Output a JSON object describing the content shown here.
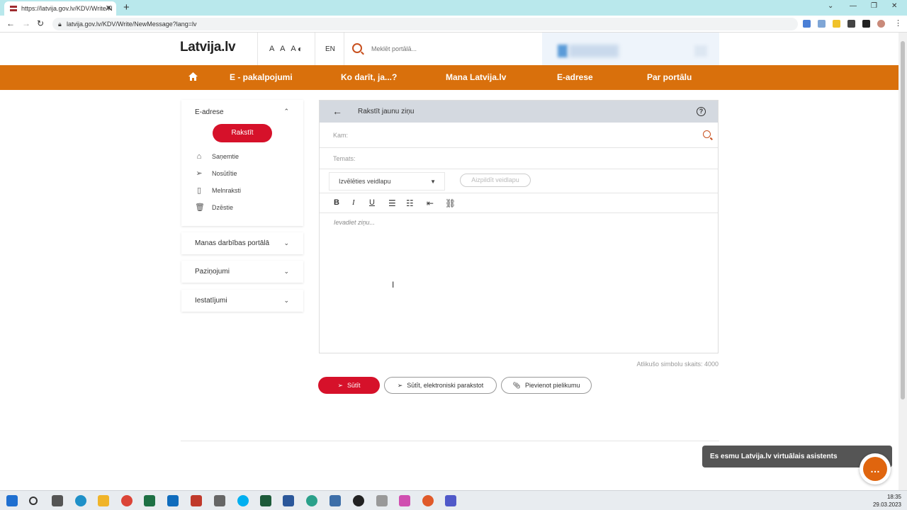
{
  "browser": {
    "tab_title": "https://latvija.gov.lv/KDV/Write/N",
    "url": "latvija.gov.lv/KDV/Write/NewMessage?lang=lv"
  },
  "site": {
    "logo": "Latvija.lv",
    "font_size_label": "A A A",
    "lang": "EN",
    "search_placeholder": "Meklēt portālā..."
  },
  "nav": {
    "items": [
      "E - pakalpojumi",
      "Ko darīt, ja...?",
      "Mana Latvija.lv",
      "E-adrese",
      "Par portālu"
    ]
  },
  "sidebar": {
    "eadrese_title": "E-adrese",
    "write_button": "Rakstīt",
    "folders": [
      {
        "label": "Saņemtie",
        "icon": "inbox-icon"
      },
      {
        "label": "Nosūtītie",
        "icon": "send-icon"
      },
      {
        "label": "Melnraksti",
        "icon": "draft-icon"
      },
      {
        "label": "Dzēstie",
        "icon": "trash-icon"
      }
    ],
    "sections": [
      "Manas darbības portālā",
      "Paziņojumi",
      "Iestatījumi"
    ]
  },
  "compose": {
    "title": "Rakstīt jaunu ziņu",
    "to_label": "Kam:",
    "subject_label": "Temats:",
    "template_select": "Izvēlēties veidlapu",
    "fill_template": "Aizpildīt veidlapu",
    "editor_placeholder": "Ievadiet ziņu...",
    "char_count": "Atlikušo simbolu skaits: 4000"
  },
  "actions": {
    "send": "Sūtīt",
    "sign_send": "Sūtīt, elektroniski parakstot",
    "attach": "Pievienot pielikumu"
  },
  "assistant": {
    "text": "Es esmu Latvija.lv virtuālais asistents"
  },
  "taskbar": {
    "time": "18:35",
    "date": "29.03.2023"
  },
  "colors": {
    "orange": "#d9700c",
    "red": "#d6112a",
    "compose_header": "#d4d9e0"
  }
}
